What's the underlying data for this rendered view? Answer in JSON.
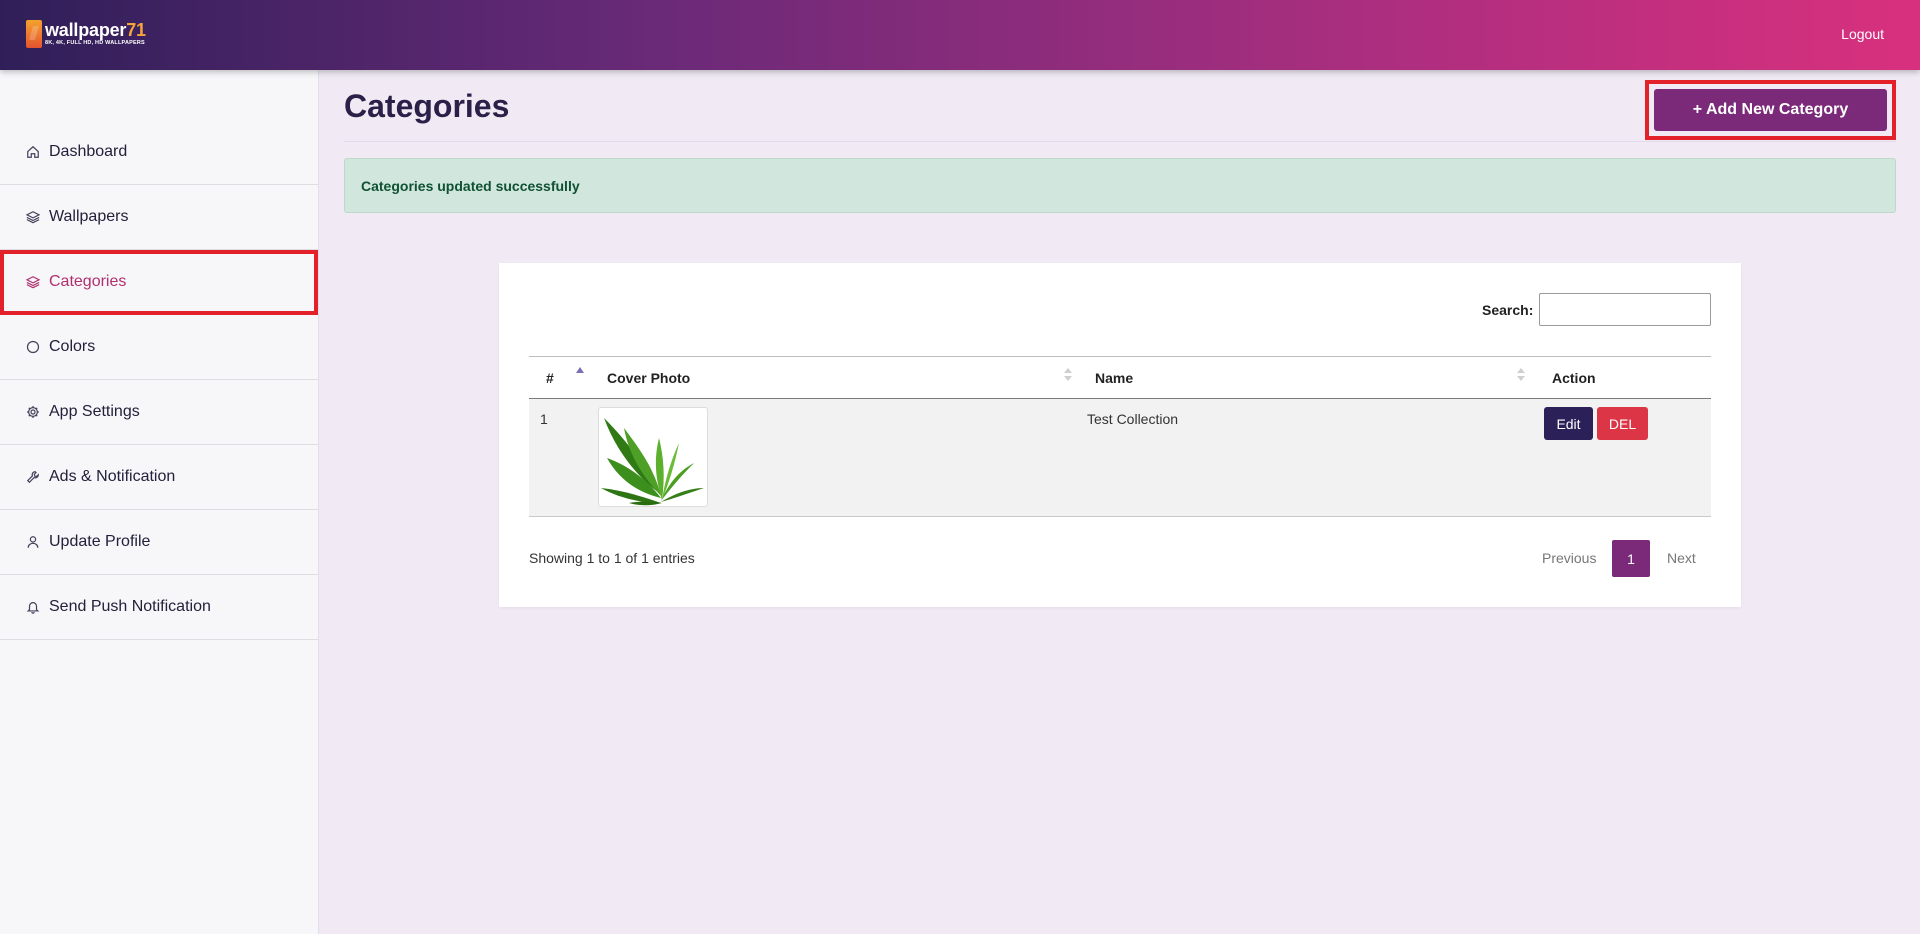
{
  "header": {
    "brand_name": "wallpaper",
    "brand_number": "71",
    "brand_tagline": "8K, 4K, FULL HD, HD WALLPAPERS",
    "logout_label": "Logout",
    "colors": {
      "gradient_start": "#2f1f59",
      "gradient_end": "#d8307e",
      "brand_accent": "#f6a53a"
    }
  },
  "sidebar": {
    "items": [
      {
        "label": "Dashboard",
        "icon": "home-icon"
      },
      {
        "label": "Wallpapers",
        "icon": "layers-icon"
      },
      {
        "label": "Categories",
        "icon": "layers-icon",
        "active": true
      },
      {
        "label": "Colors",
        "icon": "circle-icon"
      },
      {
        "label": "App Settings",
        "icon": "gear-icon"
      },
      {
        "label": "Ads & Notification",
        "icon": "wrench-icon"
      },
      {
        "label": "Update Profile",
        "icon": "user-icon"
      },
      {
        "label": "Send Push Notification",
        "icon": "bell-icon"
      }
    ],
    "active_color": "#b0306f"
  },
  "main": {
    "title": "Categories",
    "add_button_label": "+ Add New Category",
    "alert_text": "Categories updated successfully",
    "table": {
      "search_label": "Search:",
      "search_value": "",
      "columns": [
        "#",
        "Cover Photo",
        "Name",
        "Action"
      ],
      "rows": [
        {
          "index": "1",
          "cover": "leaf-image",
          "name": "Test Collection",
          "edit_label": "Edit",
          "delete_label": "DEL"
        }
      ],
      "info": "Showing 1 to 1 of 1 entries",
      "pagination": {
        "previous": "Previous",
        "current": "1",
        "next": "Next"
      }
    },
    "colors": {
      "primary": "#7b2a79",
      "edit": "#2c2058",
      "delete": "#dc3545",
      "alert_bg": "#d1e7dd"
    }
  }
}
